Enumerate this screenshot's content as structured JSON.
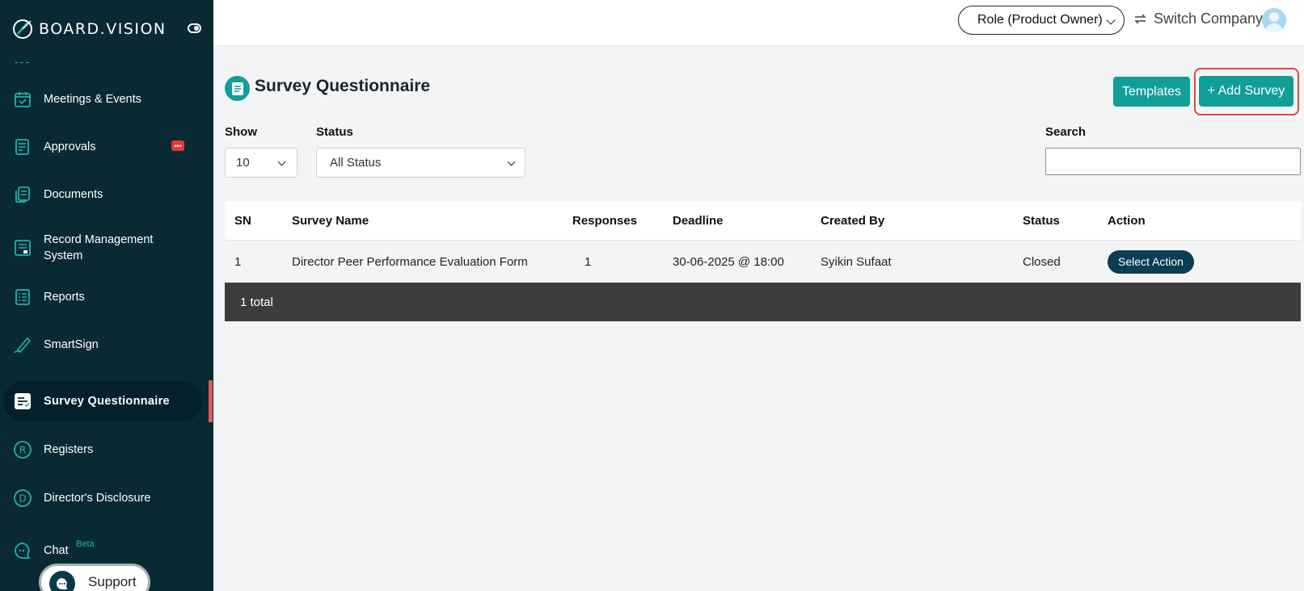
{
  "sidebar": {
    "logo_text": "BOARD.VISION",
    "dashes": "---",
    "items": [
      {
        "label": "Meetings & Events"
      },
      {
        "label": "Approvals"
      },
      {
        "label": "Documents"
      },
      {
        "label": "Record Management System"
      },
      {
        "label": "Reports"
      },
      {
        "label": "SmartSign"
      },
      {
        "label": "Survey Questionnaire"
      },
      {
        "label": "Registers"
      },
      {
        "label": "Director's Disclosure"
      },
      {
        "label": "Chat"
      }
    ],
    "approvals_badge": "•••",
    "chat_beta": "Beta",
    "support_label": "Support",
    "accent_color": "#1fb3a6"
  },
  "header": {
    "role": "Role (Product Owner)",
    "switch_company": "Switch Company"
  },
  "main": {
    "title": "Survey Questionnaire",
    "templates_label": "Templates",
    "add_survey_label": "+ Add Survey",
    "filters": {
      "show_label": "Show",
      "show_value": "10",
      "status_label": "Status",
      "status_value": "All Status",
      "search_label": "Search",
      "search_value": ""
    },
    "table": {
      "headers": [
        "SN",
        "Survey Name",
        "Responses",
        "Deadline",
        "Created By",
        "Status",
        "Action"
      ],
      "rows": [
        {
          "sn": "1",
          "name": "Director Peer Performance Evaluation Form",
          "responses": "1",
          "deadline": "30-06-2025 @ 18:00",
          "created_by": "Syikin Sufaat",
          "status": "Closed",
          "action": "Select Action"
        }
      ],
      "footer": "1 total"
    },
    "brand_color": "#119e98"
  }
}
